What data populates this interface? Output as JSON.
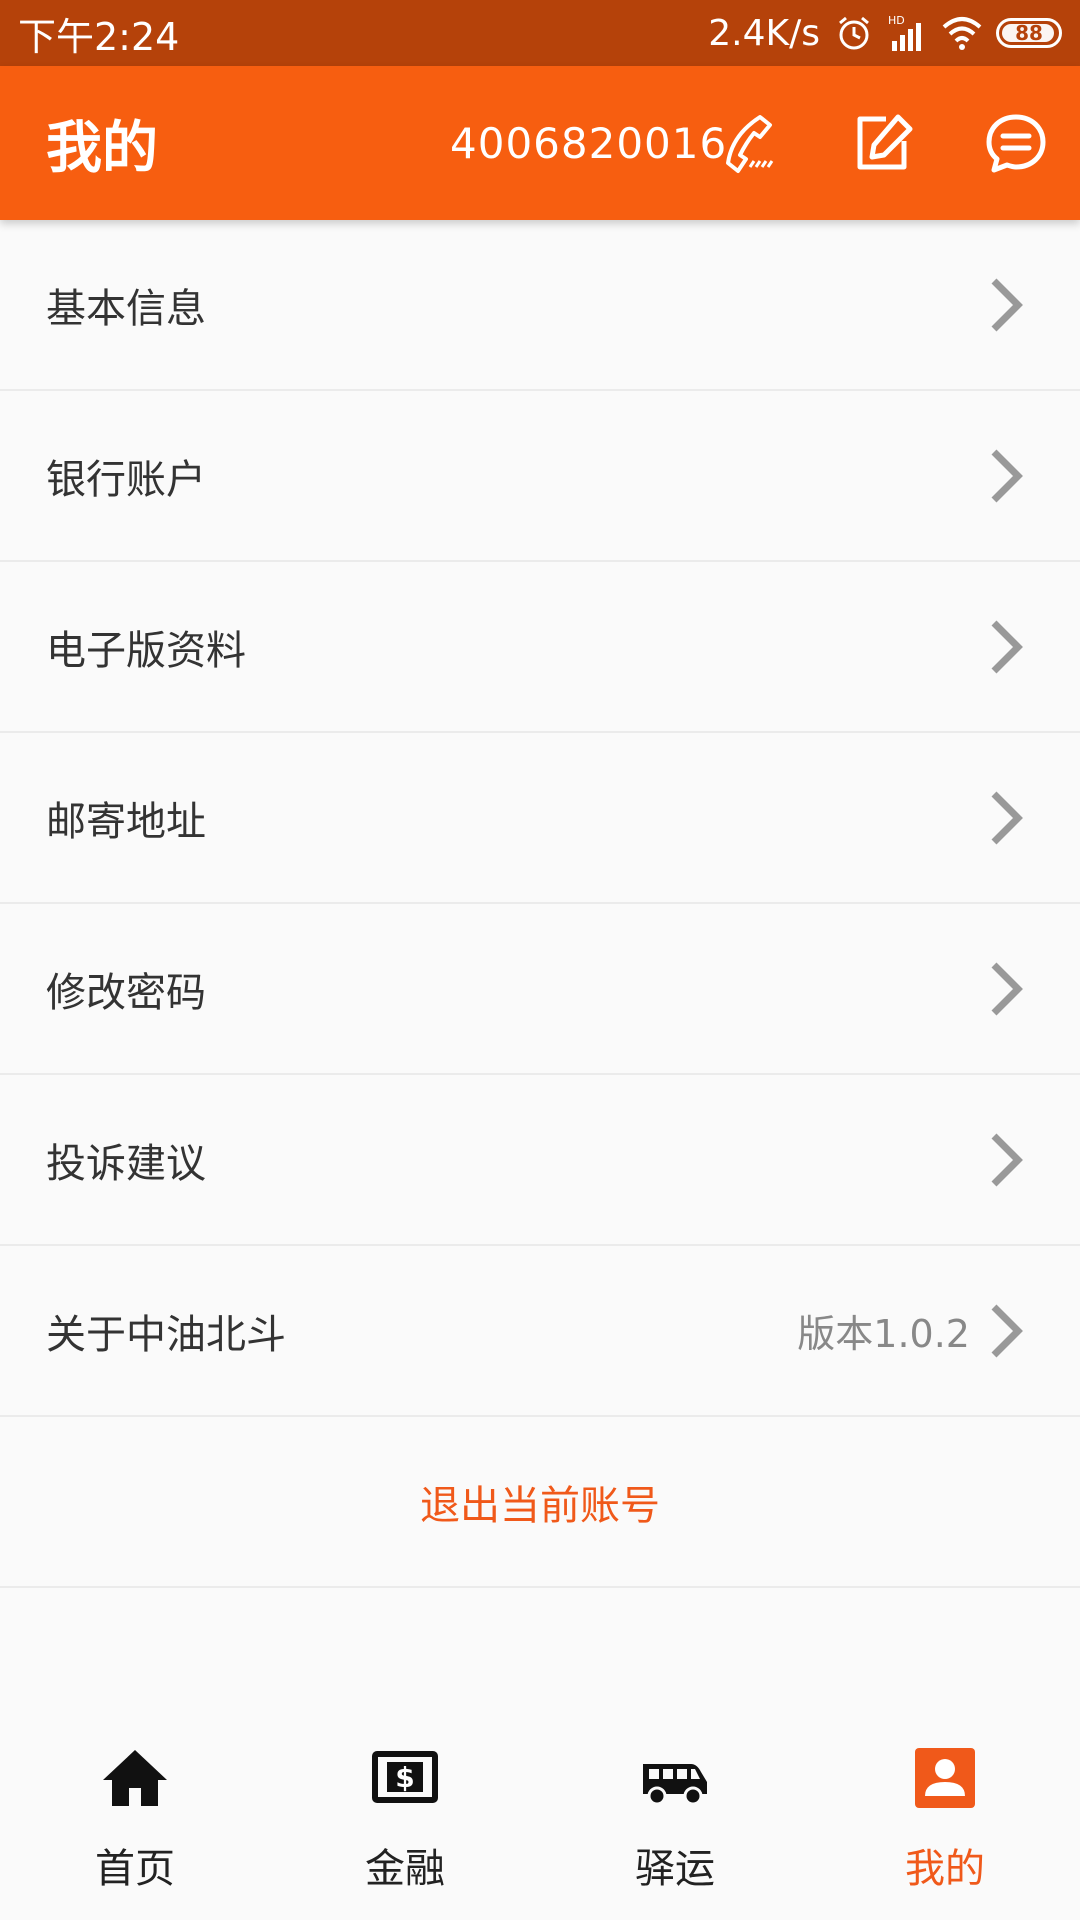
{
  "status_bar": {
    "time": "下午2:24",
    "speed": "2.4K/s",
    "battery": "88",
    "icons": [
      "alarm-icon",
      "hd-signal-icon",
      "wifi-icon",
      "battery-icon"
    ]
  },
  "app_bar": {
    "title": "我的",
    "phone": "4006820016",
    "icons": [
      "phone-icon",
      "edit-icon",
      "message-icon"
    ],
    "color": "#f75e10"
  },
  "menu": {
    "items": [
      {
        "label": "基本信息"
      },
      {
        "label": "银行账户"
      },
      {
        "label": "电子版资料"
      },
      {
        "label": "邮寄地址"
      },
      {
        "label": "修改密码"
      },
      {
        "label": "投诉建议"
      },
      {
        "label": "关于中油北斗",
        "extra": "版本1.0.2"
      }
    ],
    "logout_label": "退出当前账号"
  },
  "tab_bar": {
    "tabs": [
      {
        "label": "首页",
        "icon": "home-icon"
      },
      {
        "label": "金融",
        "icon": "dollar-icon"
      },
      {
        "label": "驿运",
        "icon": "van-icon"
      },
      {
        "label": "我的",
        "icon": "profile-icon",
        "active": true
      }
    ],
    "active_color": "#f0591a"
  }
}
